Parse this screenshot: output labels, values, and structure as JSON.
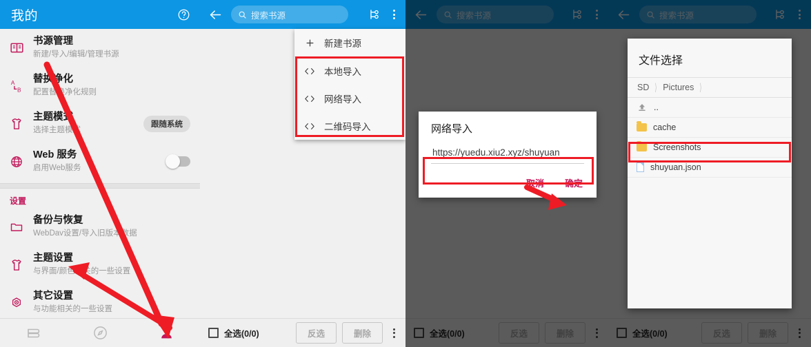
{
  "panel1": {
    "appbar": {
      "title": "我的",
      "help_icon": "help-circle-icon"
    },
    "settings": [
      {
        "icon": "book-icon",
        "title": "书源管理",
        "subtitle": "新建/导入/编辑/管理书源"
      },
      {
        "icon": "replace-icon",
        "title": "替换净化",
        "subtitle": "配置替换净化规则"
      },
      {
        "icon": "shirt-icon",
        "title": "主题模式",
        "subtitle": "选择主题模式",
        "chip": "跟随系统"
      },
      {
        "icon": "globe-icon",
        "title": "Web 服务",
        "subtitle": "启用Web服务",
        "switch": "off"
      }
    ],
    "section_label": "设置",
    "settings2": [
      {
        "icon": "folder-icon",
        "title": "备份与恢复",
        "subtitle": "WebDav设置/导入旧版本数据"
      },
      {
        "icon": "shirt-icon",
        "title": "主题设置",
        "subtitle": "与界面/颜色相关的一些设置"
      },
      {
        "icon": "gear-icon",
        "title": "其它设置",
        "subtitle": "与功能相关的一些设置"
      }
    ],
    "bottom_nav": [
      {
        "icon": "bookshelf-icon",
        "active": false
      },
      {
        "icon": "compass-icon",
        "active": false
      },
      {
        "icon": "person-icon",
        "active": true
      }
    ]
  },
  "panel2": {
    "appbar": {
      "back_icon": "back-arrow-icon",
      "search_placeholder": "搜索书源",
      "search_icon": "search-icon",
      "group_icon": "group-filter-icon",
      "more_icon": "overflow-menu-icon"
    },
    "menu": [
      {
        "icon": "plus-icon",
        "label": "新建书源"
      },
      {
        "icon": "code-icon",
        "label": "本地导入"
      },
      {
        "icon": "code-icon",
        "label": "网络导入"
      },
      {
        "icon": "code-icon",
        "label": "二维码导入"
      }
    ],
    "selectbar": {
      "select_all": "全选(0/0)",
      "invert": "反选",
      "delete": "删除",
      "more_icon": "overflow-menu-icon"
    }
  },
  "panel3": {
    "appbar": {
      "back_icon": "back-arrow-icon",
      "search_placeholder": "搜索书源",
      "search_icon": "search-icon",
      "group_icon": "group-filter-icon",
      "more_icon": "overflow-menu-icon"
    },
    "dialog": {
      "title": "网络导入",
      "input_value": "https://yuedu.xiu2.xyz/shuyuan",
      "cancel": "取消",
      "confirm": "确定"
    },
    "selectbar": {
      "select_all": "全选(0/0)",
      "invert": "反选",
      "delete": "删除",
      "more_icon": "overflow-menu-icon"
    }
  },
  "panel4": {
    "appbar": {
      "back_icon": "back-arrow-icon",
      "search_placeholder": "搜索书源",
      "search_icon": "search-icon",
      "group_icon": "group-filter-icon",
      "more_icon": "overflow-menu-icon"
    },
    "dialog": {
      "title": "文件选择",
      "breadcrumbs": [
        "SD",
        "Pictures"
      ],
      "rows": [
        {
          "icon": "up-arrow-icon",
          "label": ".."
        },
        {
          "icon": "folder-icon",
          "label": "cache"
        },
        {
          "icon": "folder-icon",
          "label": "Screenshots"
        },
        {
          "icon": "file-icon",
          "label": "shuyuan.json"
        }
      ]
    },
    "selectbar": {
      "select_all": "全选(0/0)",
      "invert": "反选",
      "delete": "删除",
      "more_icon": "overflow-menu-icon"
    }
  },
  "annotations": {
    "color": "#ee1c25",
    "boxes": [
      "menu-import-items",
      "network-url-input",
      "file-shuyuan-json"
    ],
    "arrows": [
      "arrow-to-person-nav",
      "arrow-to-other-settings",
      "arrow-to-confirm-button"
    ]
  }
}
